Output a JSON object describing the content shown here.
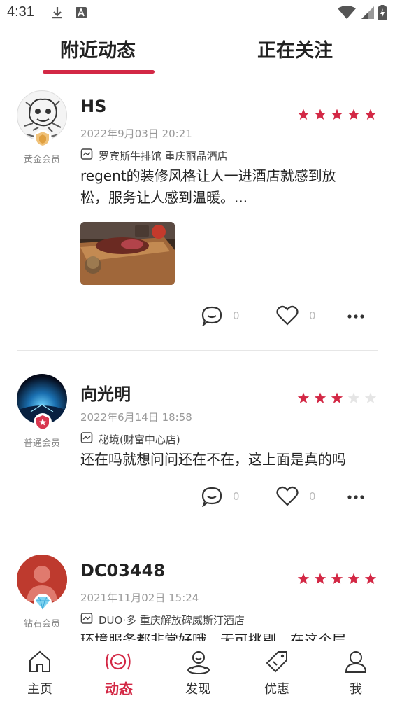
{
  "status_bar": {
    "time": "4:31"
  },
  "top_tabs": [
    {
      "label": "附近动态",
      "active": true
    },
    {
      "label": "正在关注",
      "active": false
    }
  ],
  "posts": [
    {
      "username": "HS",
      "member_level": "黄金会员",
      "rating": 5,
      "date": "2022年9月03日 20:21",
      "location": "罗宾斯牛排馆 重庆丽晶酒店",
      "text_lines": [
        "regent的装修风格让人一进酒店就感到放",
        "松，服务让人感到温暖。..."
      ],
      "has_photo": true,
      "comments": "0",
      "likes": "0"
    },
    {
      "username": "向光明",
      "member_level": "普通会员",
      "rating": 3,
      "date": "2022年6月14日 18:58",
      "location": "秘境(财富中心店)",
      "text_lines": [
        "还在吗就想问问还在不在，这上面是真的吗"
      ],
      "has_photo": false,
      "comments": "0",
      "likes": "0"
    },
    {
      "username": "DC03448",
      "member_level": "钻石会员",
      "rating": 5,
      "date": "2021年11月02日 15:24",
      "location": "DUO·多 重庆解放碑威斯汀酒店",
      "text_lines": [
        "环境服务都非常好哦，无可挑剔，在这个层"
      ],
      "has_photo": false
    }
  ],
  "bottom_nav": [
    {
      "label": "主页",
      "icon": "home-icon",
      "active": false
    },
    {
      "label": "动态",
      "icon": "moments-icon",
      "active": true
    },
    {
      "label": "发现",
      "icon": "discover-icon",
      "active": false
    },
    {
      "label": "优惠",
      "icon": "coupon-icon",
      "active": false
    },
    {
      "label": "我",
      "icon": "profile-icon",
      "active": false
    }
  ],
  "colors": {
    "accent": "#d32845",
    "star_empty": "#e5e5e5"
  }
}
